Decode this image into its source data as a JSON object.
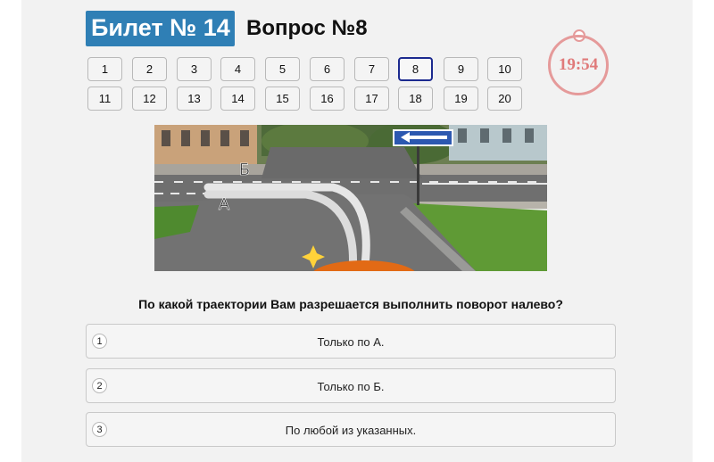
{
  "header": {
    "ticket_label": "Билет № 14",
    "question_label": "Вопрос №8"
  },
  "timer": {
    "value": "19:54"
  },
  "question_nav": {
    "current": 8,
    "buttons": [
      "1",
      "2",
      "3",
      "4",
      "5",
      "6",
      "7",
      "8",
      "9",
      "10",
      "11",
      "12",
      "13",
      "14",
      "15",
      "16",
      "17",
      "18",
      "19",
      "20"
    ]
  },
  "scene": {
    "label_a": "А",
    "label_b": "Б"
  },
  "question": {
    "text": "По какой траектории Вам разрешается выполнить поворот налево?"
  },
  "answers": [
    {
      "num": "1",
      "text": "Только по А."
    },
    {
      "num": "2",
      "text": "Только по Б."
    },
    {
      "num": "3",
      "text": "По любой из указанных."
    }
  ],
  "colors": {
    "badge_bg": "#2f7fb5",
    "active_border": "#1c2a8f",
    "timer": "#e07a7a"
  }
}
